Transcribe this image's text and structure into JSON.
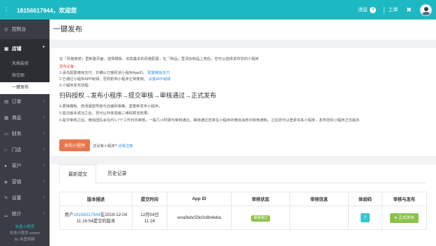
{
  "topbar": {
    "menu_icon": "menu-dots-icon",
    "user": "18156017944，欢迎您",
    "messages_label": "消息",
    "messages_count": "4",
    "workorder_label": "工单",
    "tool_icon": "wrench-icon"
  },
  "sidebar": {
    "items": [
      {
        "label": "控制台",
        "icon": "dashboard-icon"
      },
      {
        "label": "店铺",
        "icon": "store-icon"
      },
      {
        "label": "订单",
        "icon": "order-icon"
      },
      {
        "label": "商品",
        "icon": "goods-icon"
      },
      {
        "label": "财务",
        "icon": "finance-icon"
      },
      {
        "label": "门店",
        "icon": "shop-icon"
      },
      {
        "label": "客户",
        "icon": "customer-icon"
      },
      {
        "label": "营销",
        "icon": "marketing-icon"
      },
      {
        "label": "设置",
        "icon": "settings-icon"
      },
      {
        "label": "统计",
        "icon": "stats-icon"
      },
      {
        "label": "账户",
        "icon": "account-icon"
      }
    ],
    "store_sub": [
      "风格装修",
      "微信图",
      "一键发布"
    ],
    "footer_line1": "米鱼小程序",
    "footer_line2": "本地小程序 power",
    "footer_line3": "by 米鱼网络"
  },
  "header": {
    "title": "一键发布"
  },
  "instructions": {
    "line1": "在「风格装修」里新建页面、选择模板、完成基本的风格配置，在「商品」里添加商品上架后，您可以选择发布您的小程序",
    "required_title": "发布必备：",
    "req1": "1.请先配置微信支付、并确认已授权该小程序AppID。",
    "req1_link": "配置微信支付",
    "req2": "2.已通过小程序APP秘钥、否则影响小程序正常使用。",
    "req2_link": "设置APP秘钥",
    "req3": "3.小程序发布流程：",
    "flow": "扫码授权→发布小程序→提交审核→审核通过→正式发布",
    "note4": "4.更换模板、修改底部导航与店铺风格等，需重新发布小程序。",
    "note5": "5.提交版本成功之后、您可以扫体验版二维码预览效果。",
    "note6": "6.提交审核之后、微信团队会在约1-7个工作日内审核，一般几小时即可审核通过。审核通过您将在小程序的微信消息中收到通知。之后您可以登录本系小程序，发布您的小程序正式版本"
  },
  "publish_button": "发布小程序",
  "hint": "还没有小程序?",
  "hint_link": "点我注册",
  "tabs": [
    "最新提交",
    "历史记录"
  ],
  "table": {
    "headers": [
      "版本描述",
      "提交时间",
      "App ID",
      "审核状态",
      "审核信息",
      "体验码",
      "审核与发布"
    ],
    "row": {
      "desc_prefix": "用户",
      "desc_user": "18156017944",
      "desc_suffix": "在2019-12-04 11:16:54提交的版本",
      "time_line1": "12月04日",
      "time_line2": "11:16",
      "appid": "wxa9ebc59c0c8b4eba",
      "status": "审核通过",
      "info": "",
      "qr_icon": "qrcode-icon",
      "publish": "正式发布"
    }
  }
}
